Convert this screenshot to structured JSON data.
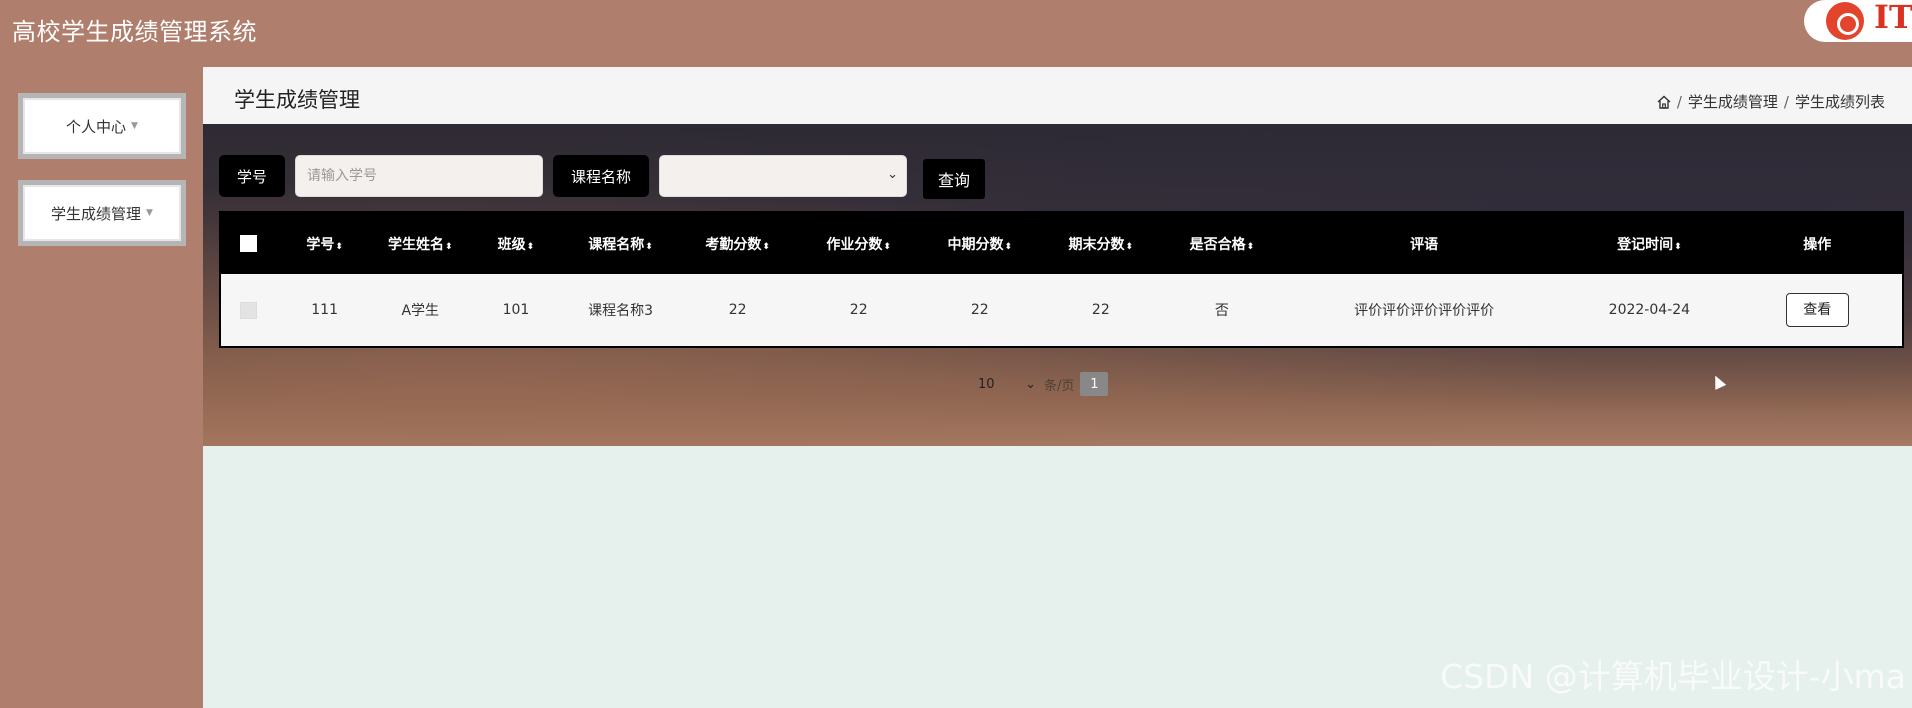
{
  "app": {
    "title": "高校学生成绩管理系统",
    "brand_text": "IT"
  },
  "sidebar": {
    "items": [
      {
        "label": "个人中心"
      },
      {
        "label": "学生成绩管理"
      }
    ]
  },
  "page": {
    "title": "学生成绩管理",
    "breadcrumb": [
      "学生成绩管理",
      "学生成绩列表"
    ]
  },
  "search": {
    "student_id_label": "学号",
    "student_id_placeholder": "请输入学号",
    "course_label": "课程名称",
    "course_value": "",
    "query_button": "查询"
  },
  "table": {
    "columns": [
      "学号",
      "学生姓名",
      "班级",
      "课程名称",
      "考勤分数",
      "作业分数",
      "中期分数",
      "期末分数",
      "是否合格",
      "评语",
      "登记时间",
      "操作"
    ],
    "rows": [
      {
        "student_id": "111",
        "student_name": "A学生",
        "class": "101",
        "course": "课程名称3",
        "attendance": "22",
        "homework": "22",
        "midterm": "22",
        "final": "22",
        "passed": "否",
        "comment": "评价评价评价评价评价",
        "date": "2022-04-24",
        "action": "查看"
      }
    ]
  },
  "pagination": {
    "page_size": "10",
    "per_page_label": "条/页",
    "current_page": "1"
  },
  "watermark": "CSDN @计算机毕业设计-小ma",
  "colors": {
    "accent": "#b07e6c",
    "header_bg": "#000000",
    "content_bg": "#e6f0ec"
  }
}
